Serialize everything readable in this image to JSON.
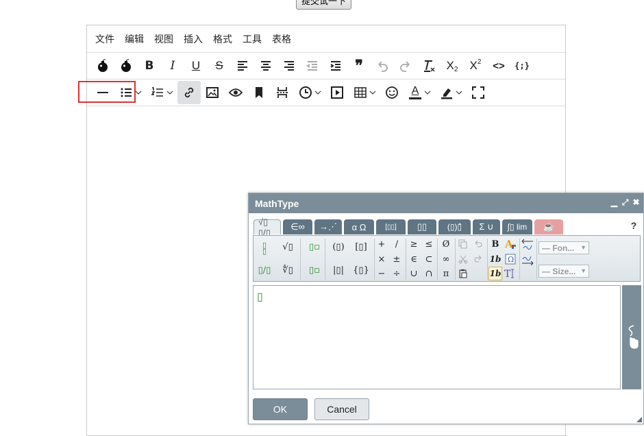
{
  "top_button": {
    "label": "提交试一下"
  },
  "menubar": {
    "items": [
      "文件",
      "编辑",
      "视图",
      "插入",
      "格式",
      "工具",
      "表格"
    ]
  },
  "toolbar": {
    "row1": [
      "bomb-icon",
      "bomb-icon",
      "bold-icon",
      "italic-icon",
      "underline-icon",
      "strikethrough-icon",
      "align-left-icon",
      "align-center-icon",
      "align-right-icon",
      "outdent-icon",
      "indent-icon",
      "blockquote-icon",
      "undo-icon",
      "redo-icon",
      "clear-format-icon",
      "subscript-icon",
      "superscript-icon",
      "code-icon",
      "code-sample-icon"
    ],
    "row2": [
      "horizontal-rule-icon",
      "bullet-list-icon",
      "numbered-list-icon",
      "link-icon",
      "image-icon",
      "preview-icon",
      "bookmark-icon",
      "page-break-icon",
      "time-icon",
      "media-icon",
      "table-icon",
      "emoticons-icon",
      "text-color-icon",
      "highlight-icon",
      "fullscreen-icon"
    ],
    "labels": {
      "bold": "B",
      "italic": "I",
      "underline": "U",
      "strike": "S",
      "quote": "❞",
      "sub_x": "X",
      "sub_n": "2",
      "sup_x": "X",
      "sup_n": "2",
      "code": "<>",
      "codesample": "{;}",
      "text_color": "A"
    }
  },
  "mathtype": {
    "title": "MathType",
    "window_buttons": [
      "▁",
      "⤢",
      "✖"
    ],
    "tabs": [
      "√▯ ▯/▯",
      "∈∞",
      "→⋰",
      "α Ω",
      "[▯▯]",
      "▯▯",
      "(▯)▯̂",
      "Σ ∪",
      "∫▯ lim",
      "☕"
    ],
    "help": "?",
    "palette": {
      "frac": "▯/▯",
      "sqrt": "√▯",
      "frac2": "▯/▯",
      "nroot": "∜▯",
      "sup": "▯▫",
      "sub": "▯▫",
      "paren": "(▯)",
      "bracket": "[▯]",
      "abs": "|▯|",
      "brace": "{▯}",
      "plus": "+",
      "slash": "/",
      "times": "×",
      "pm": "±",
      "minus": "−",
      "div": "÷",
      "ge": "≥",
      "le": "≤",
      "in": "∈",
      "subset": "⊂",
      "cup": "∪",
      "cap": "∩",
      "empty": "Ø",
      "inf": "∞",
      "pi": "π",
      "bold": "B",
      "italic_1b": "1b",
      "italic_1b_sel": "1b",
      "font_placeholder": "— Fon...",
      "size_placeholder": "— Size..."
    },
    "editor_cursor": "▯",
    "ok_label": "OK",
    "cancel_label": "Cancel"
  }
}
